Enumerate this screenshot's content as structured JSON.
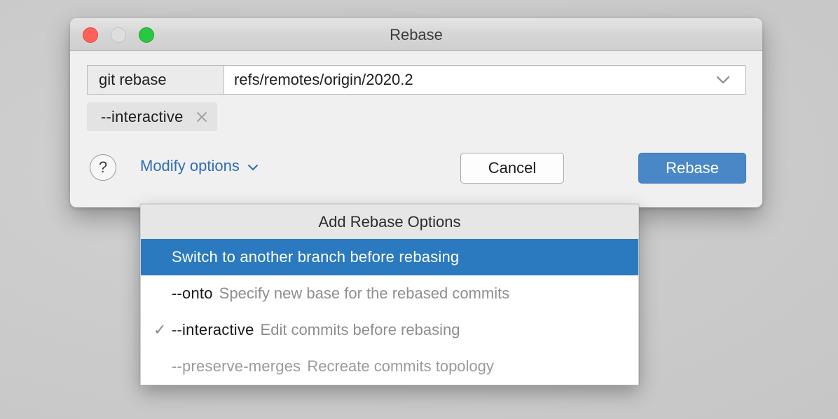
{
  "window": {
    "title": "Rebase",
    "controls": {
      "close": "close-button",
      "minimize": "minimize-button",
      "zoom": "zoom-button"
    }
  },
  "command": {
    "prefix_label": "git rebase",
    "branch_value": "refs/remotes/origin/2020.2",
    "branch_placeholder": "refs/remotes/origin/2020.2",
    "dropdown_icon": "chevron-down-icon"
  },
  "chips": [
    {
      "label": "--interactive",
      "remove_icon": "close-icon"
    }
  ],
  "footer": {
    "help_label": "?",
    "modify_options_label": "Modify options",
    "modify_options_icon": "chevron-down-icon",
    "cancel_label": "Cancel",
    "rebase_label": "Rebase"
  },
  "popup": {
    "header": "Add Rebase Options",
    "items": [
      {
        "check": "",
        "flag": "Switch to another branch before rebasing",
        "desc": "",
        "selected": true,
        "disabled": false
      },
      {
        "check": "",
        "flag": "--onto",
        "desc": "Specify new base for the rebased commits",
        "selected": false,
        "disabled": false
      },
      {
        "check": "✓",
        "flag": "--interactive",
        "desc": "Edit commits before rebasing",
        "selected": false,
        "disabled": false
      },
      {
        "check": "",
        "flag": "--preserve-merges",
        "desc": "Recreate commits topology",
        "selected": false,
        "disabled": true
      }
    ]
  },
  "colors": {
    "accent_blue": "#4a87c7",
    "selection_blue": "#2b7ac0",
    "link_blue": "#2f6db5",
    "dialog_bg": "#f0f0f0",
    "traffic_close": "#ff6159",
    "traffic_minimize": "#dedede",
    "traffic_zoom": "#28c840"
  }
}
